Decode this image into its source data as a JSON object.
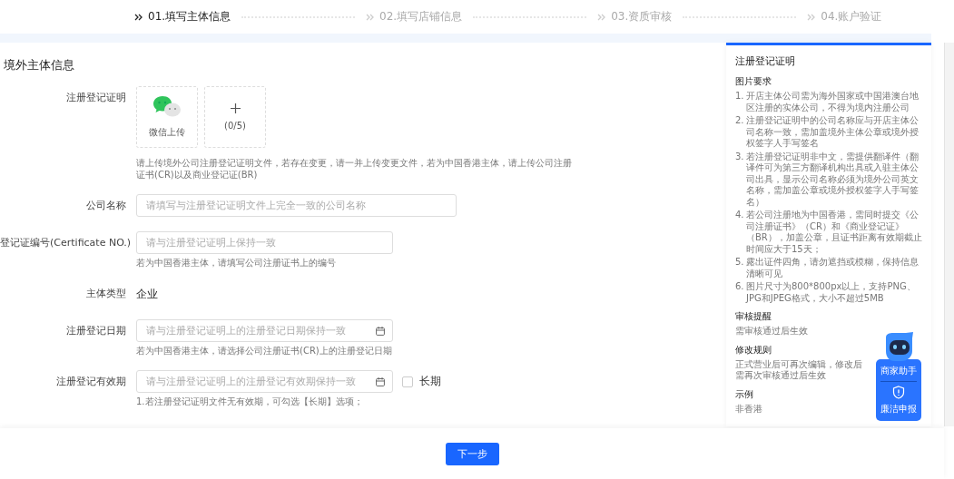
{
  "steps": [
    {
      "label": "01.填写主体信息",
      "selected": true
    },
    {
      "label": "02.填写店铺信息",
      "selected": false
    },
    {
      "label": "03.资质审核",
      "selected": false
    },
    {
      "label": "04.账户验证",
      "selected": false
    }
  ],
  "section_title": "境外主体信息",
  "upload": {
    "label": "注册登记证明",
    "wechat_label": "微信上传",
    "count": "(0/5)",
    "hint": "请上传境外公司注册登记证明文件，若存在变更，请一并上传变更文件，若为中国香港主体，请上传公司注册证书(CR)以及商业登记证(BR)"
  },
  "fields": [
    {
      "kind": "text",
      "label": "公司名称",
      "placeholder": "请填写与注册登记证明文件上完全一致的公司名称",
      "wide": true
    },
    {
      "kind": "text",
      "label": "登记证编号(Certificate NO.)",
      "placeholder": "请与注册登记证明上保持一致",
      "wide": false,
      "hint": "若为中国香港主体，请填写公司注册证书上的编号"
    },
    {
      "kind": "static",
      "label": "主体类型",
      "value": "企业"
    },
    {
      "kind": "date",
      "label": "注册登记日期",
      "placeholder": "请与注册登记证明上的注册登记日期保持一致",
      "hint": "若为中国香港主体，请选择公司注册证书(CR)上的注册登记日期"
    },
    {
      "kind": "date",
      "label": "注册登记有效期",
      "placeholder": "请与注册登记证明上的注册登记有效期保持一致",
      "checkbox": {
        "label": "长期",
        "checked": false
      },
      "hint": "1.若注册登记证明文件无有效期，可勾选【长期】选项；"
    }
  ],
  "panel": {
    "title": "注册登记证明",
    "sections": [
      {
        "heading": "图片要求",
        "items": [
          {
            "num": "1.",
            "text": "开店主体公司需为海外国家或中国港澳台地区注册的实体公司，不得为境内注册公司"
          },
          {
            "num": "2.",
            "text": "注册登记证明中的公司名称应与开店主体公司名称一致，需加盖境外主体公章或境外授权签字人手写签名"
          },
          {
            "num": "3.",
            "text": "若注册登记证明非中文，需提供翻译件（翻译件可为第三方翻译机构出具或入驻主体公司出具，显示公司名称必须为境外公司英文名称，需加盖公章或境外授权签字人手写签名）"
          },
          {
            "num": "4.",
            "text": "若公司注册地为中国香港，需同时提交《公司注册证书》（CR）和《商业登记证》（BR），加盖公章，且证书距离有效期截止时间应大于15天；"
          },
          {
            "num": "5.",
            "text": "露出证件四角，请勿遮挡或模糊，保持信息清晰可见"
          },
          {
            "num": "6.",
            "text": "图片尺寸为800*800px以上，支持PNG、JPG和JPEG格式，大小不超过5MB"
          }
        ]
      },
      {
        "heading": "审核提醒",
        "text": "需审核通过后生效"
      },
      {
        "heading": "修改规则",
        "text": "正式营业后可再次编辑，修改后需再次审核通过后生效"
      },
      {
        "heading": "示例",
        "text": "非香港"
      }
    ]
  },
  "assistant": {
    "label": "商家助手",
    "report": "廉洁申报"
  },
  "next_button": "下一步"
}
